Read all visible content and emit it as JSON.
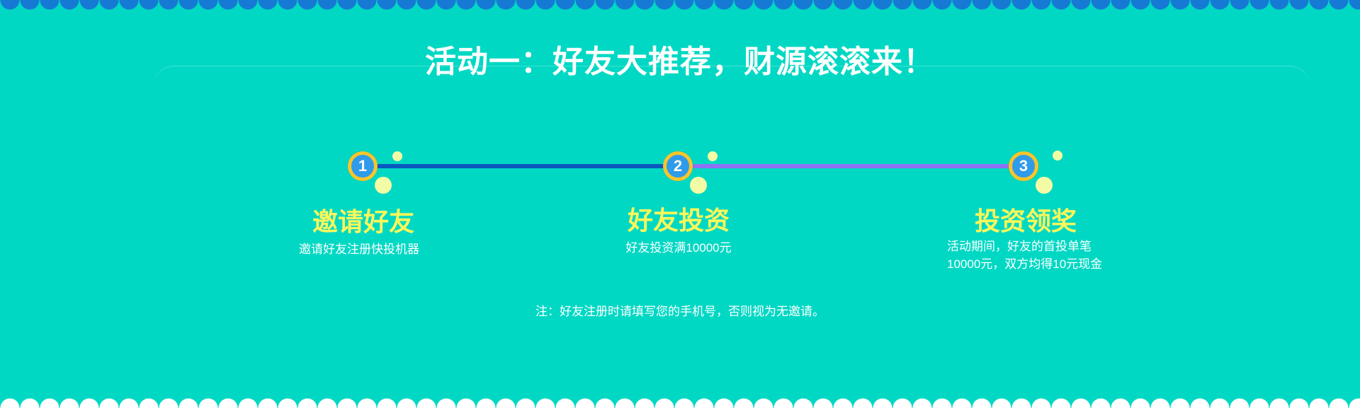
{
  "title": "活动一：好友大推荐，财源滚滚来！",
  "colors": {
    "background": "#01d8c4",
    "top_scallop": "#1679d4",
    "bottom_scallop": "#ffffff",
    "step_title": "#fbf75a",
    "line_1": "#0a58bd",
    "line_2": "#9071f4",
    "circle_ring": "#f8c52a",
    "circle_fill": "#2f9bea"
  },
  "steps": [
    {
      "number": "1",
      "title": "邀请好友",
      "desc": [
        "邀请好友注册快投机器"
      ]
    },
    {
      "number": "2",
      "title": "好友投资",
      "desc": [
        "好友投资满10000元"
      ]
    },
    {
      "number": "3",
      "title": "投资领奖",
      "desc": [
        "活动期间，好友的首投单笔",
        "10000元，双方均得10元现金"
      ]
    }
  ],
  "note": "注：好友注册时请填写您的手机号，否则视为无邀请。"
}
